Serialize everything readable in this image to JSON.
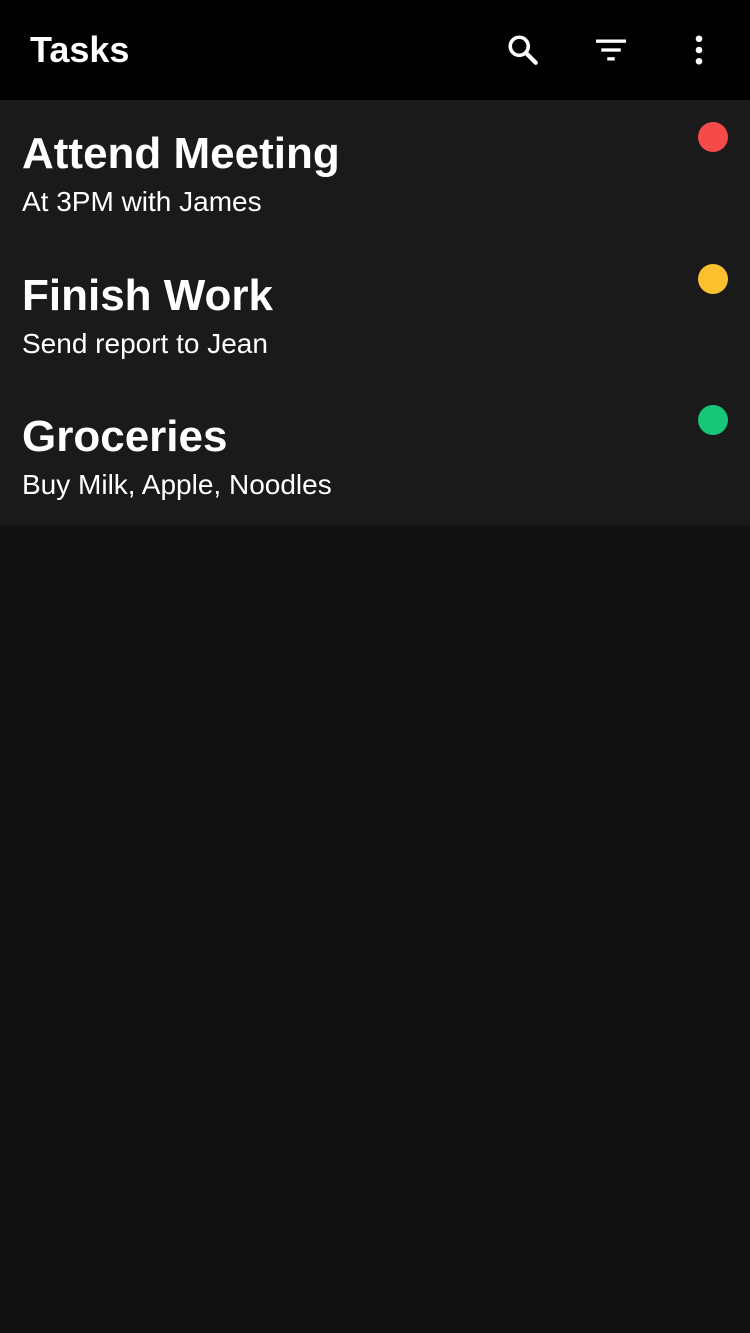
{
  "app_bar": {
    "title": "Tasks",
    "actions": [
      {
        "name": "search",
        "icon": "search-icon"
      },
      {
        "name": "filter",
        "icon": "filter-icon"
      },
      {
        "name": "more",
        "icon": "more-vert-icon"
      }
    ]
  },
  "tasks": [
    {
      "title": "Attend Meeting",
      "subtitle": "At 3PM with James",
      "priority_color": "#f44a4a"
    },
    {
      "title": "Finish Work",
      "subtitle": "Send report to Jean",
      "priority_color": "#fbc02d"
    },
    {
      "title": "Groceries",
      "subtitle": "Buy Milk, Apple, Noodles",
      "priority_color": "#18c67a"
    }
  ],
  "colors": {
    "background": "#121212",
    "app_bar": "#000000",
    "list_background": "#1a1a1a",
    "text": "#ffffff"
  }
}
